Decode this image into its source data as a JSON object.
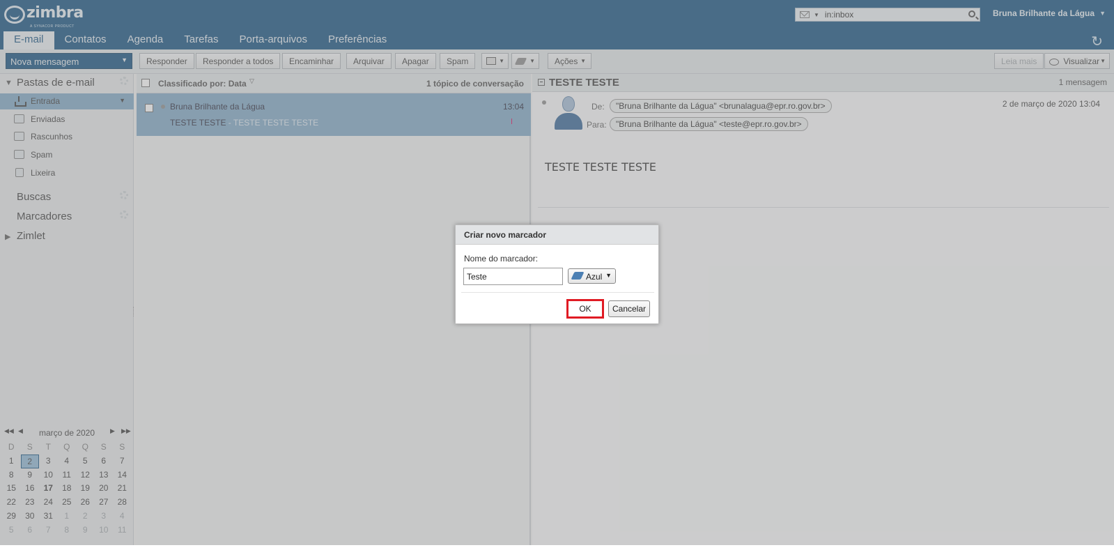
{
  "app": {
    "logo_text": "zimbra",
    "logo_sub": "A SYNACOR PRODUCT"
  },
  "search": {
    "value": "in:inbox"
  },
  "user": {
    "name": "Bruna Brilhante da Lágua"
  },
  "tabs": [
    "E-mail",
    "Contatos",
    "Agenda",
    "Tarefas",
    "Porta-arquivos",
    "Preferências"
  ],
  "toolbar": {
    "new_message": "Nova mensagem",
    "reply": "Responder",
    "reply_all": "Responder a todos",
    "forward": "Encaminhar",
    "archive": "Arquivar",
    "delete": "Apagar",
    "spam": "Spam",
    "actions": "Ações",
    "read_more": "Leia mais",
    "view": "Visualizar"
  },
  "sidebar": {
    "mail_folders": "Pastas de e-mail",
    "folders": [
      {
        "label": "Entrada",
        "selected": true
      },
      {
        "label": "Enviadas"
      },
      {
        "label": "Rascunhos"
      },
      {
        "label": "Spam"
      },
      {
        "label": "Lixeira"
      }
    ],
    "searches": "Buscas",
    "tags": "Marcadores",
    "zimlets": "Zimlet"
  },
  "calendar": {
    "month": "março de 2020",
    "dow": [
      "D",
      "S",
      "T",
      "Q",
      "Q",
      "S",
      "S"
    ],
    "weeks": [
      [
        "1",
        "2",
        "3",
        "4",
        "5",
        "6",
        "7"
      ],
      [
        "8",
        "9",
        "10",
        "11",
        "12",
        "13",
        "14"
      ],
      [
        "15",
        "16",
        "17",
        "18",
        "19",
        "20",
        "21"
      ],
      [
        "22",
        "23",
        "24",
        "25",
        "26",
        "27",
        "28"
      ],
      [
        "29",
        "30",
        "31",
        "1",
        "2",
        "3",
        "4"
      ],
      [
        "5",
        "6",
        "7",
        "8",
        "9",
        "10",
        "11"
      ]
    ],
    "selected_day": "2",
    "today": "17"
  },
  "list": {
    "sort_label": "Classificado por: Data",
    "count": "1 tópico de conversação",
    "message": {
      "from": "Bruna Brilhante da Lágua",
      "time": "13:04",
      "subject": "TESTE TESTE",
      "fragment": " - TESTE TESTE TESTE"
    }
  },
  "reading": {
    "subject": "TESTE TESTE",
    "count": "1 mensagem",
    "from_label": "De:",
    "from": "\"Bruna Brilhante da Lágua\" <brunalagua@epr.ro.gov.br>",
    "to_label": "Para:",
    "to": "\"Bruna Brilhante da Lágua\" <teste@epr.ro.gov.br>",
    "date": "2 de março de 2020 13:04",
    "body": "TESTE TESTE TESTE"
  },
  "dialog": {
    "title": "Criar novo marcador",
    "name_label": "Nome do marcador:",
    "name_value": "Teste",
    "color": "Azul",
    "ok": "OK",
    "cancel": "Cancelar"
  },
  "colors": {
    "header": "#0a4a7a",
    "selection": "#7aa4c4",
    "highlight": "#e01b24"
  }
}
